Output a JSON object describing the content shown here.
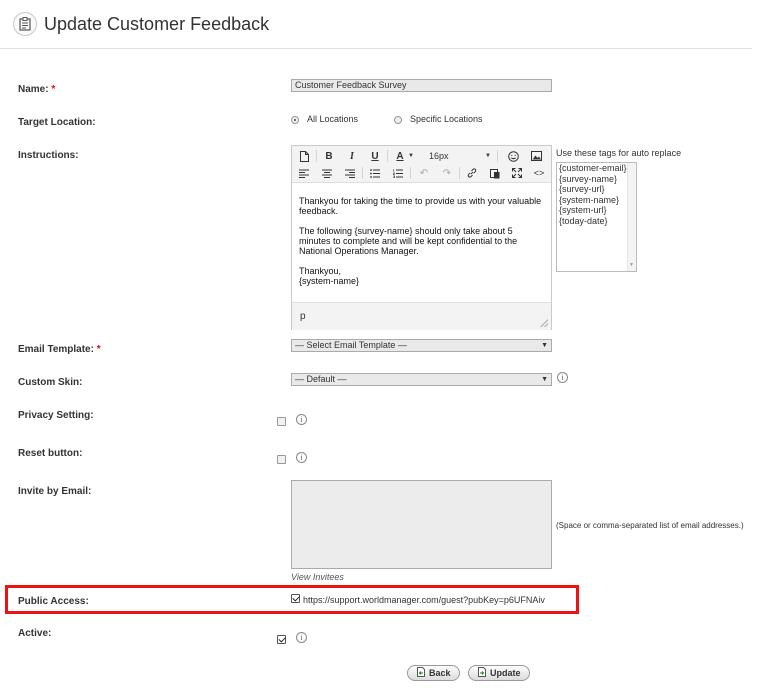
{
  "header": {
    "title": "Update Customer Feedback",
    "icon": "clipboard-icon"
  },
  "form": {
    "name": {
      "label": "Name:",
      "required_mark": "*",
      "value": "Customer Feedback Survey"
    },
    "target_location": {
      "label": "Target Location:",
      "options": [
        "All Locations",
        "Specific Locations"
      ],
      "selected": "All Locations"
    },
    "instructions": {
      "label": "Instructions:",
      "font_size": "16px",
      "body_paragraphs": [
        "Thankyou for taking the time to provide us with your valuable feedback.",
        "The following {survey-name} should only take about 5 minutes to complete and will be kept confidential to the National Operations Manager.",
        "Thankyou,"
      ],
      "signature": "{system-name}",
      "status_path": "p",
      "tags_label": "Use these tags for auto replace",
      "tags": [
        "{customer-email}",
        "{survey-name}",
        "{survey-url}",
        "{system-name}",
        "{system-url}",
        "{today-date}"
      ]
    },
    "email_template": {
      "label": "Email Template:",
      "required_mark": "*",
      "value": "— Select Email Template —"
    },
    "custom_skin": {
      "label": "Custom Skin:",
      "value": "— Default —"
    },
    "privacy_setting": {
      "label": "Privacy Setting:",
      "checked": false
    },
    "reset_button": {
      "label": "Reset button:",
      "checked": false
    },
    "invite_by_email": {
      "label": "Invite by Email:",
      "value": "",
      "hint": "(Space or comma-separated list of email addresses.)",
      "view_invitees": "View Invitees"
    },
    "public_access": {
      "label": "Public Access:",
      "checked": true,
      "url": "https://support.worldmanager.com/guest?pubKey=p6UFNAiv"
    },
    "active": {
      "label": "Active:",
      "checked": true
    }
  },
  "actions": {
    "back_label": "Back",
    "update_label": "Update"
  },
  "colors": {
    "highlight": "#ee1111",
    "required": "#ee0000"
  }
}
